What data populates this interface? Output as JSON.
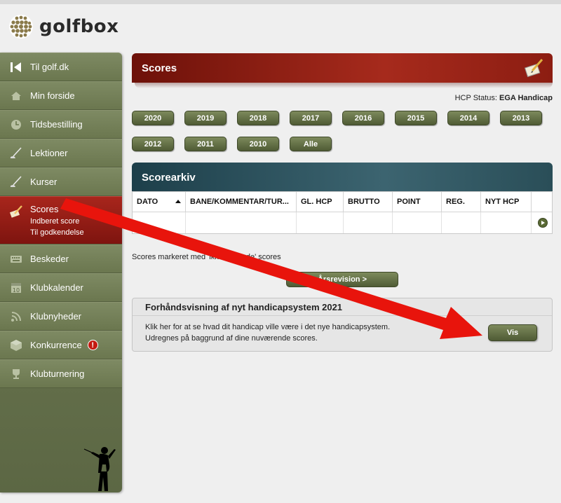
{
  "brand": {
    "name": "golfbox"
  },
  "colors": {
    "accent_red": "#a62a1c",
    "sidebar_green": "#6a7650",
    "archive_teal": "#3c6470",
    "overlay_arrow": "#e8140c"
  },
  "sidebar": {
    "items": [
      {
        "label": "Til golf.dk",
        "icon": "back-arrow-icon"
      },
      {
        "label": "Min forside",
        "icon": "home-icon"
      },
      {
        "label": "Tidsbestilling",
        "icon": "clock-icon"
      },
      {
        "label": "Lektioner",
        "icon": "golf-club-icon"
      },
      {
        "label": "Kurser",
        "icon": "golf-club-icon"
      },
      {
        "label": "Scores",
        "icon": "scorecard-pen-icon",
        "active": true,
        "sub": [
          "Indberet score",
          "Til godkendelse"
        ]
      },
      {
        "label": "Beskeder",
        "icon": "keyboard-icon"
      },
      {
        "label": "Klubkalender",
        "icon": "calendar-icon"
      },
      {
        "label": "Klubnyheder",
        "icon": "rss-icon"
      },
      {
        "label": "Konkurrence",
        "icon": "cube-icon",
        "badge": "!"
      },
      {
        "label": "Klubturnering",
        "icon": "trophy-icon"
      }
    ]
  },
  "scores": {
    "title": "Scores",
    "hcp_status_label": "HCP Status:",
    "hcp_status_value": "EGA Handicap",
    "years_row1": [
      "2020",
      "2019",
      "2018",
      "2017",
      "2016",
      "2015",
      "2014",
      "2013"
    ],
    "years_row2": [
      "2012",
      "2011",
      "2010",
      "Alle"
    ]
  },
  "archive": {
    "title": "Scorearkiv",
    "columns": [
      "DATO",
      "BANE/KOMMENTAR/TUR...",
      "GL. HCP",
      "BRUTTO",
      "POINT",
      "REG.",
      "NYT HCP"
    ]
  },
  "note": "Scores markeret med 'ikke tællende' scores",
  "arsrevision_label": "Årsrevision >",
  "preview": {
    "title": "Forhåndsvisning af nyt handicapsystem 2021",
    "line1": "Klik her for at se hvad dit handicap ville være i det nye handicapsystem.",
    "line2": "Udregnes på baggrund af dine nuværende scores.",
    "button": "Vis"
  }
}
